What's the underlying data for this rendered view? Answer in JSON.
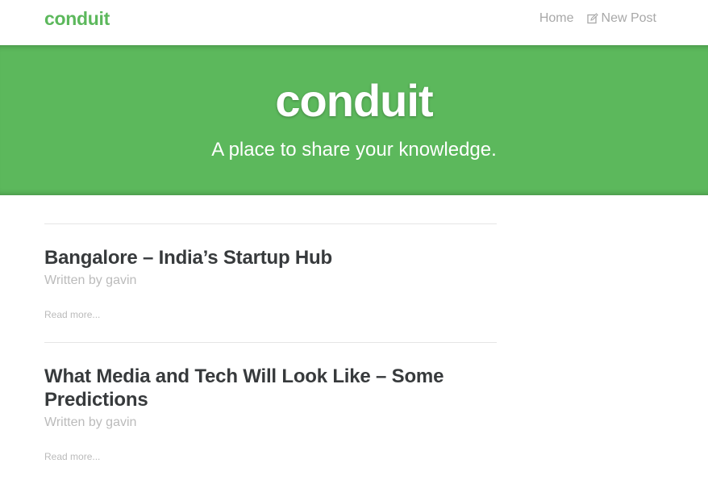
{
  "navbar": {
    "brand": "conduit",
    "links": [
      {
        "label": "Home",
        "icon": null
      },
      {
        "label": "New Post",
        "icon": "edit-icon"
      }
    ]
  },
  "banner": {
    "title": "conduit",
    "subtitle": "A place to share your knowledge."
  },
  "articles": [
    {
      "title": "Bangalore – India’s Startup Hub",
      "meta": "Written by gavin",
      "read_more": "Read more..."
    },
    {
      "title": "What Media and Tech Will Look Like – Some Predictions",
      "meta": "Written by gavin",
      "read_more": "Read more..."
    }
  ],
  "colors": {
    "brand_green": "#5cb85c",
    "muted_text": "#bbbbbb",
    "nav_link": "#a8a8a8"
  }
}
